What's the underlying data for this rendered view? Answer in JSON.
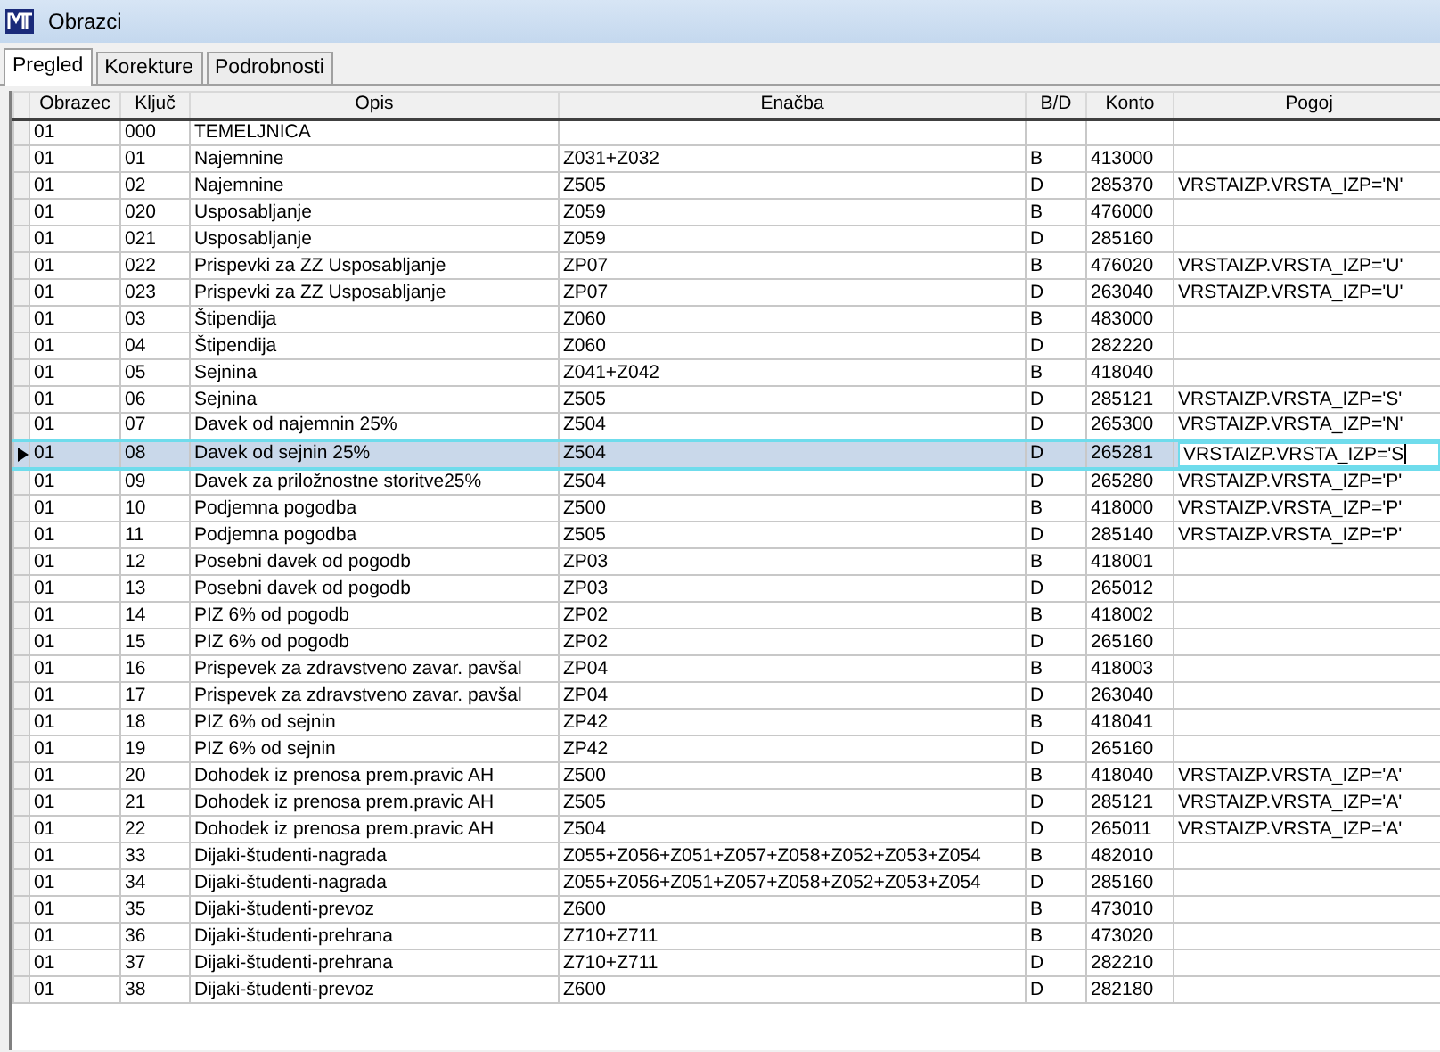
{
  "window": {
    "title": "Obrazci"
  },
  "tabs": [
    {
      "label": "Pregled",
      "selected": true
    },
    {
      "label": "Korekture",
      "selected": false
    },
    {
      "label": "Podrobnosti",
      "selected": false
    }
  ],
  "table": {
    "columns": [
      "Obrazec",
      "Ključ",
      "Opis",
      "Enačba",
      "B/D",
      "Konto",
      "Pogoj"
    ],
    "rows": [
      {
        "obrazec": "01",
        "kljuc": "000",
        "opis": "TEMELJNICA",
        "selected": false
      },
      {
        "obrazec": "01",
        "kljuc": "01",
        "opis": "Najemnine",
        "enacba": "Z031+Z032",
        "bd": "B",
        "konto": "413000",
        "selected": false
      },
      {
        "obrazec": "01",
        "kljuc": "02",
        "opis": "Najemnine",
        "enacba": "Z505",
        "bd": "D",
        "konto": "285370",
        "pogoj": "VRSTAIZP.VRSTA_IZP='N'",
        "selected": false
      },
      {
        "obrazec": "01",
        "kljuc": "020",
        "opis": "Usposabljanje",
        "enacba": "Z059",
        "bd": "B",
        "konto": "476000",
        "selected": false
      },
      {
        "obrazec": "01",
        "kljuc": "021",
        "opis": "Usposabljanje",
        "enacba": "Z059",
        "bd": "D",
        "konto": "285160",
        "selected": false
      },
      {
        "obrazec": "01",
        "kljuc": "022",
        "opis": "Prispevki za ZZ Usposabljanje",
        "enacba": "ZP07",
        "bd": "B",
        "konto": "476020",
        "pogoj": "VRSTAIZP.VRSTA_IZP='U'",
        "selected": false
      },
      {
        "obrazec": "01",
        "kljuc": "023",
        "opis": "Prispevki za ZZ Usposabljanje",
        "enacba": "ZP07",
        "bd": "D",
        "konto": "263040",
        "pogoj": "VRSTAIZP.VRSTA_IZP='U'",
        "selected": false
      },
      {
        "obrazec": "01",
        "kljuc": "03",
        "opis": "Štipendija",
        "enacba": "Z060",
        "bd": "B",
        "konto": "483000",
        "selected": false
      },
      {
        "obrazec": "01",
        "kljuc": "04",
        "opis": "Štipendija",
        "enacba": "Z060",
        "bd": "D",
        "konto": "282220",
        "selected": false
      },
      {
        "obrazec": "01",
        "kljuc": "05",
        "opis": "Sejnina",
        "enacba": "Z041+Z042",
        "bd": "B",
        "konto": "418040",
        "selected": false
      },
      {
        "obrazec": "01",
        "kljuc": "06",
        "opis": "Sejnina",
        "enacba": "Z505",
        "bd": "D",
        "konto": "285121",
        "pogoj": "VRSTAIZP.VRSTA_IZP='S'",
        "selected": false
      },
      {
        "obrazec": "01",
        "kljuc": "07",
        "opis": "Davek od najemnin 25%",
        "enacba": "Z504",
        "bd": "D",
        "konto": "265300",
        "pogoj": "VRSTAIZP.VRSTA_IZP='N'",
        "selected": false
      },
      {
        "obrazec": "01",
        "kljuc": "08",
        "opis": "Davek od sejnin 25%",
        "enacba": "Z504",
        "bd": "D",
        "konto": "265281",
        "pogoj": "VRSTAIZP.VRSTA_IZP='S",
        "selected": true
      },
      {
        "obrazec": "01",
        "kljuc": "09",
        "opis": "Davek za priložnostne storitve25%",
        "enacba": "Z504",
        "bd": "D",
        "konto": "265280",
        "pogoj": "VRSTAIZP.VRSTA_IZP='P'",
        "selected": false
      },
      {
        "obrazec": "01",
        "kljuc": "10",
        "opis": "Podjemna pogodba",
        "enacba": "Z500",
        "bd": "B",
        "konto": "418000",
        "pogoj": "VRSTAIZP.VRSTA_IZP='P'",
        "selected": false
      },
      {
        "obrazec": "01",
        "kljuc": "11",
        "opis": "Podjemna pogodba",
        "enacba": "Z505",
        "bd": "D",
        "konto": "285140",
        "pogoj": "VRSTAIZP.VRSTA_IZP='P'",
        "selected": false
      },
      {
        "obrazec": "01",
        "kljuc": "12",
        "opis": "Posebni davek od pogodb",
        "enacba": "ZP03",
        "bd": "B",
        "konto": "418001",
        "selected": false
      },
      {
        "obrazec": "01",
        "kljuc": "13",
        "opis": "Posebni davek od pogodb",
        "enacba": "ZP03",
        "bd": "D",
        "konto": "265012",
        "selected": false
      },
      {
        "obrazec": "01",
        "kljuc": "14",
        "opis": "PIZ 6% od pogodb",
        "enacba": "ZP02",
        "bd": "B",
        "konto": "418002",
        "selected": false
      },
      {
        "obrazec": "01",
        "kljuc": "15",
        "opis": "PIZ 6% od pogodb",
        "enacba": "ZP02",
        "bd": "D",
        "konto": "265160",
        "selected": false
      },
      {
        "obrazec": "01",
        "kljuc": "16",
        "opis": "Prispevek za zdravstveno zavar. pavšal",
        "enacba": "ZP04",
        "bd": "B",
        "konto": "418003",
        "selected": false
      },
      {
        "obrazec": "01",
        "kljuc": "17",
        "opis": "Prispevek za zdravstveno zavar. pavšal",
        "enacba": "ZP04",
        "bd": "D",
        "konto": "263040",
        "selected": false
      },
      {
        "obrazec": "01",
        "kljuc": "18",
        "opis": "PIZ 6% od sejnin",
        "enacba": "ZP42",
        "bd": "B",
        "konto": "418041",
        "selected": false
      },
      {
        "obrazec": "01",
        "kljuc": "19",
        "opis": "PIZ 6% od sejnin",
        "enacba": "ZP42",
        "bd": "D",
        "konto": "265160",
        "selected": false
      },
      {
        "obrazec": "01",
        "kljuc": "20",
        "opis": "Dohodek iz prenosa prem.pravic AH",
        "enacba": "Z500",
        "bd": "B",
        "konto": "418040",
        "pogoj": "VRSTAIZP.VRSTA_IZP='A'",
        "selected": false
      },
      {
        "obrazec": "01",
        "kljuc": "21",
        "opis": "Dohodek iz prenosa prem.pravic AH",
        "enacba": "Z505",
        "bd": "D",
        "konto": "285121",
        "pogoj": "VRSTAIZP.VRSTA_IZP='A'",
        "selected": false
      },
      {
        "obrazec": "01",
        "kljuc": "22",
        "opis": "Dohodek iz prenosa prem.pravic AH",
        "enacba": "Z504",
        "bd": "D",
        "konto": "265011",
        "pogoj": "VRSTAIZP.VRSTA_IZP='A'",
        "selected": false
      },
      {
        "obrazec": "01",
        "kljuc": "33",
        "opis": "Dijaki-študenti-nagrada",
        "enacba": "Z055+Z056+Z051+Z057+Z058+Z052+Z053+Z054",
        "bd": "B",
        "konto": "482010",
        "selected": false
      },
      {
        "obrazec": "01",
        "kljuc": "34",
        "opis": "Dijaki-študenti-nagrada",
        "enacba": "Z055+Z056+Z051+Z057+Z058+Z052+Z053+Z054",
        "bd": "D",
        "konto": "285160",
        "selected": false
      },
      {
        "obrazec": "01",
        "kljuc": "35",
        "opis": "Dijaki-študenti-prevoz",
        "enacba": "Z600",
        "bd": "B",
        "konto": "473010",
        "selected": false
      },
      {
        "obrazec": "01",
        "kljuc": "36",
        "opis": "Dijaki-študenti-prehrana",
        "enacba": "Z710+Z711",
        "bd": "B",
        "konto": "473020",
        "selected": false
      },
      {
        "obrazec": "01",
        "kljuc": "37",
        "opis": "Dijaki-študenti-prehrana",
        "enacba": "Z710+Z711",
        "bd": "D",
        "konto": "282210",
        "selected": false
      },
      {
        "obrazec": "01",
        "kljuc": "38",
        "opis": "Dijaki-študenti-prevoz",
        "enacba": "Z600",
        "bd": "D",
        "konto": "282180",
        "selected": false
      }
    ]
  }
}
